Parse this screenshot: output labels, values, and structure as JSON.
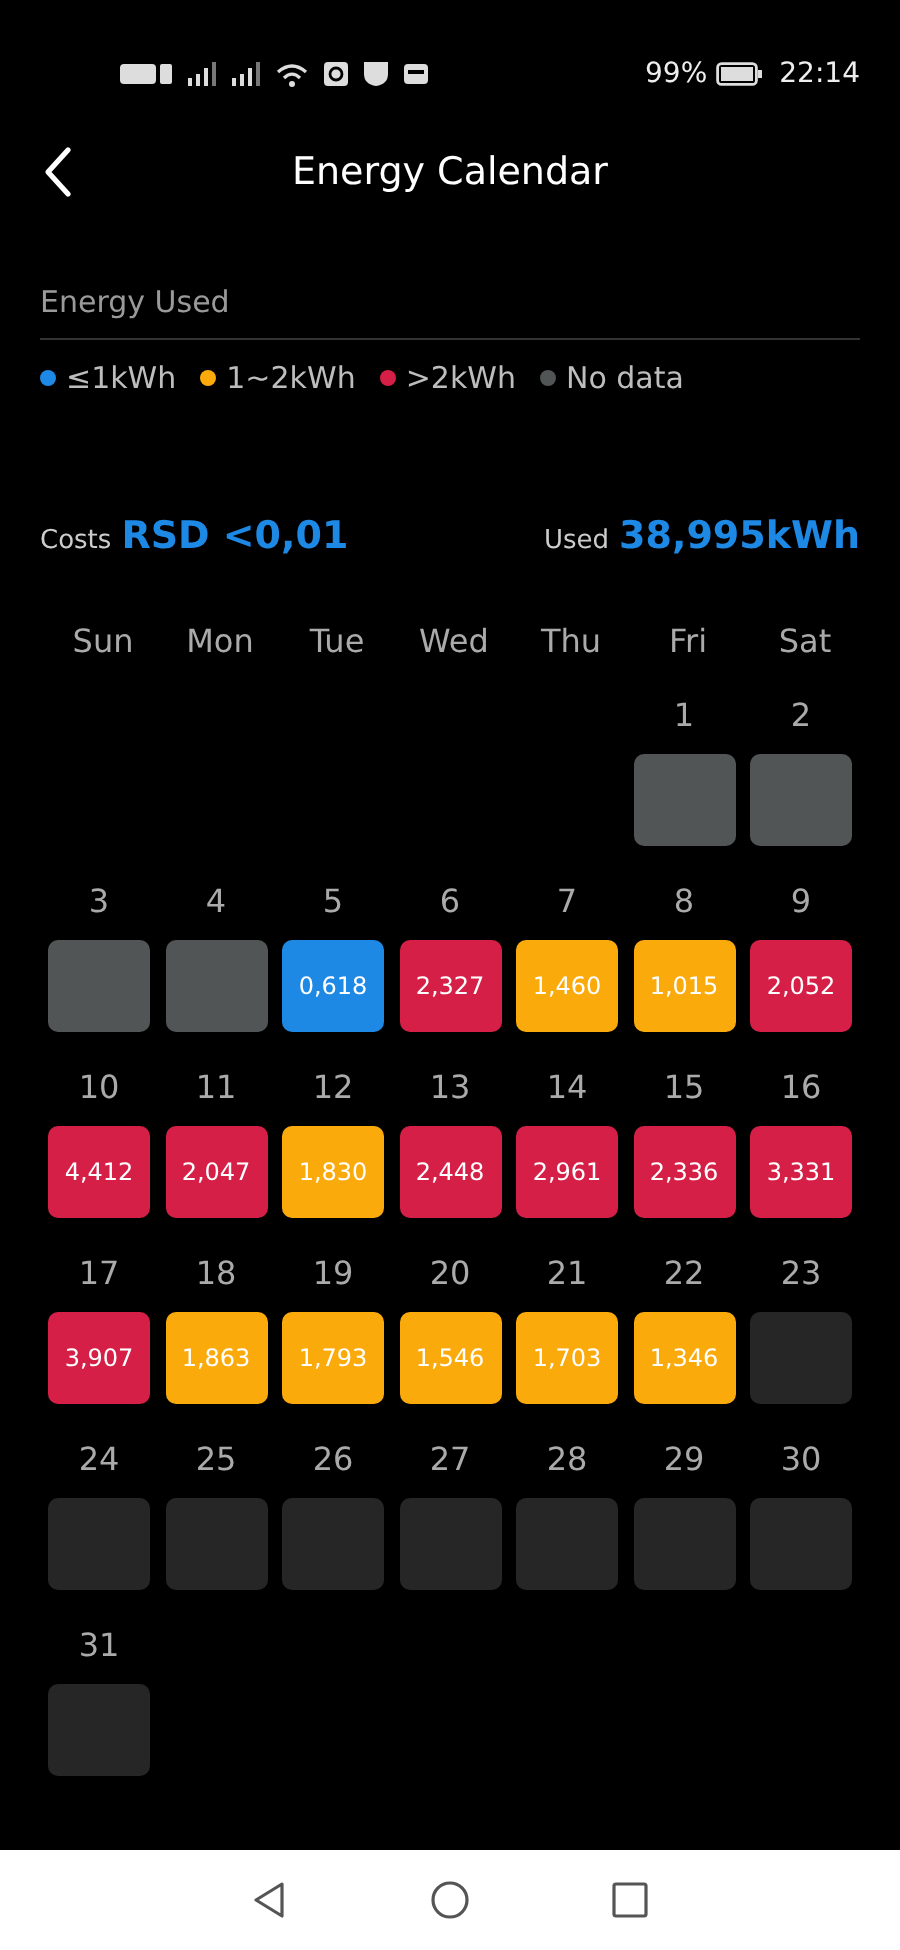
{
  "status_bar": {
    "battery": "99%",
    "time": "22:14"
  },
  "header": {
    "title": "Energy Calendar"
  },
  "section": {
    "title": "Energy Used"
  },
  "legend": [
    {
      "kind": "low",
      "label": "≤1kWh",
      "color": "#1e88e5"
    },
    {
      "kind": "mid",
      "label": "1~2kWh",
      "color": "#fbaa0c"
    },
    {
      "kind": "high",
      "label": ">2kWh",
      "color": "#d51f47"
    },
    {
      "kind": "none",
      "label": "No data",
      "color": "#515556"
    }
  ],
  "summary": {
    "costs_label": "Costs",
    "costs_value": "RSD <0,01",
    "used_label": "Used",
    "used_value": "38,995kWh"
  },
  "weekdays": [
    "Sun",
    "Mon",
    "Tue",
    "Wed",
    "Thu",
    "Fri",
    "Sat"
  ],
  "weeks": [
    [
      {
        "kind": "blank"
      },
      {
        "kind": "blank"
      },
      {
        "kind": "blank"
      },
      {
        "kind": "blank"
      },
      {
        "kind": "blank"
      },
      {
        "day": "1",
        "kind": "none"
      },
      {
        "day": "2",
        "kind": "none"
      }
    ],
    [
      {
        "day": "3",
        "kind": "none"
      },
      {
        "day": "4",
        "kind": "none"
      },
      {
        "day": "5",
        "kind": "low",
        "value": "0,618"
      },
      {
        "day": "6",
        "kind": "high",
        "value": "2,327"
      },
      {
        "day": "7",
        "kind": "mid",
        "value": "1,460"
      },
      {
        "day": "8",
        "kind": "mid",
        "value": "1,015"
      },
      {
        "day": "9",
        "kind": "high",
        "value": "2,052"
      }
    ],
    [
      {
        "day": "10",
        "kind": "high",
        "value": "4,412"
      },
      {
        "day": "11",
        "kind": "high",
        "value": "2,047"
      },
      {
        "day": "12",
        "kind": "mid",
        "value": "1,830"
      },
      {
        "day": "13",
        "kind": "high",
        "value": "2,448"
      },
      {
        "day": "14",
        "kind": "high",
        "value": "2,961"
      },
      {
        "day": "15",
        "kind": "high",
        "value": "2,336"
      },
      {
        "day": "16",
        "kind": "high",
        "value": "3,331"
      }
    ],
    [
      {
        "day": "17",
        "kind": "high",
        "value": "3,907"
      },
      {
        "day": "18",
        "kind": "mid",
        "value": "1,863"
      },
      {
        "day": "19",
        "kind": "mid",
        "value": "1,793"
      },
      {
        "day": "20",
        "kind": "mid",
        "value": "1,546"
      },
      {
        "day": "21",
        "kind": "mid",
        "value": "1,703"
      },
      {
        "day": "22",
        "kind": "mid",
        "value": "1,346"
      },
      {
        "day": "23",
        "kind": "future"
      }
    ],
    [
      {
        "day": "24",
        "kind": "future"
      },
      {
        "day": "25",
        "kind": "future"
      },
      {
        "day": "26",
        "kind": "future"
      },
      {
        "day": "27",
        "kind": "future"
      },
      {
        "day": "28",
        "kind": "future"
      },
      {
        "day": "29",
        "kind": "future"
      },
      {
        "day": "30",
        "kind": "future"
      }
    ],
    [
      {
        "day": "31",
        "kind": "future"
      }
    ]
  ]
}
